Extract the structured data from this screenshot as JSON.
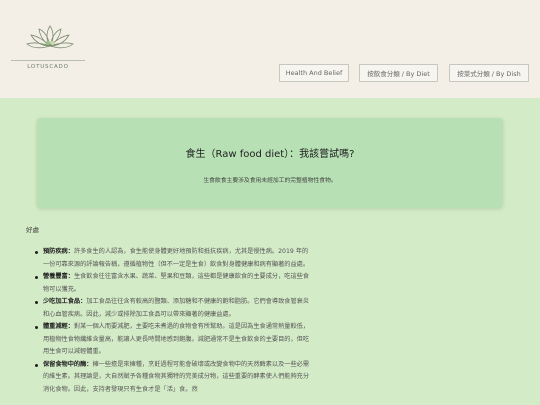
{
  "brand": {
    "name": "LOTUSCADO"
  },
  "nav": {
    "items": [
      {
        "label": "Health And Belief"
      },
      {
        "label": "按飲食分類 / By Diet"
      },
      {
        "label": "按菜式分類 / By Dish"
      }
    ]
  },
  "hero": {
    "title": "食生（Raw food diet）：我該嘗試嗎?",
    "subtitle": "生食飲食主要涉及食用未經加工的完整植物性食物。"
  },
  "intro": "好處",
  "points": [
    {
      "term": "預防疾病：",
      "text": "許多食生的人認為，食生能使身體更好地預防和抵抗疾病，尤其是慢性病。2019 年的一份可靠來源的評論報告稱，遵循植物性（但不一定是生食）飲食對身體健康和病有顯著的益處。"
    },
    {
      "term": "營養豐富：",
      "text": "生食飲食往往富含水果、蔬菜、堅果和豆類，這些都是健康飲食的主要成分，吃這些食物可以獲充。"
    },
    {
      "term": "少吃加工食品：",
      "text": "加工食品往往含有較高的鹽類、添加糖和不健康的飽和脂肪。它們會導致食管衰炎和心血管疾病。因此，減少或排除加工食品可以帶來顯著的健康益處。"
    },
    {
      "term": "體重減輕：",
      "text": "對某一個人而要減肥，主要吃未煮過的食物會有所幫助。這是因為生食通常熱量較低，用植物性食物纖維含量高，能讓人更長時間地感到飽腹。減肥通常不是生食飲食的主要目的，但吃用生食可以減輕體重。"
    },
    {
      "term": "保留食物中的酶：",
      "text": "擁一些擔是來擁種，烹飪過程可能會破壞或改變食物中的天然酶素以及一些必需的維生素。其理論是，大自然賦予各種食物其獨特的完美成分物，這些重要的酵素使人們能夠充分消化食物。因此，支持者發現只有生食才是「活」食。然"
    }
  ]
}
